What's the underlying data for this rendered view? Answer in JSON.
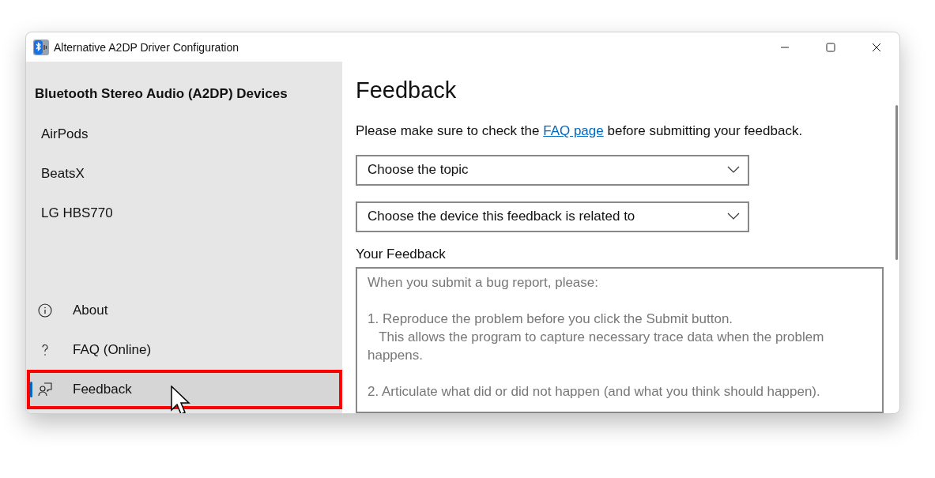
{
  "window": {
    "title": "Alternative A2DP Driver Configuration"
  },
  "sidebar": {
    "heading": "Bluetooth Stereo Audio (A2DP) Devices",
    "devices": [
      {
        "label": "AirPods",
        "selected": false
      },
      {
        "label": "BeatsX",
        "selected": false
      },
      {
        "label": "LG HBS770",
        "selected": false
      }
    ],
    "footer_items": [
      {
        "label": "About",
        "kind": "info",
        "selected": false
      },
      {
        "label": "FAQ (Online)",
        "kind": "help",
        "selected": false
      },
      {
        "label": "Feedback",
        "kind": "feedback",
        "selected": true
      }
    ]
  },
  "page": {
    "title": "Feedback",
    "intro": {
      "before": "Please make sure to check the ",
      "link": "FAQ page",
      "after": " before submitting your feedback."
    },
    "dropdowns": [
      {
        "placeholder": "Choose the topic"
      },
      {
        "placeholder": "Choose the device this feedback is related to"
      }
    ],
    "feedback_label": "Your Feedback",
    "feedback_placeholder": "When you submit a bug report, please:\n\n1. Reproduce the problem before you click the Submit button.\n   This allows the program to capture necessary trace data when the problem happens.\n\n2. Articulate what did or did not happen (and what you think should happen)."
  }
}
